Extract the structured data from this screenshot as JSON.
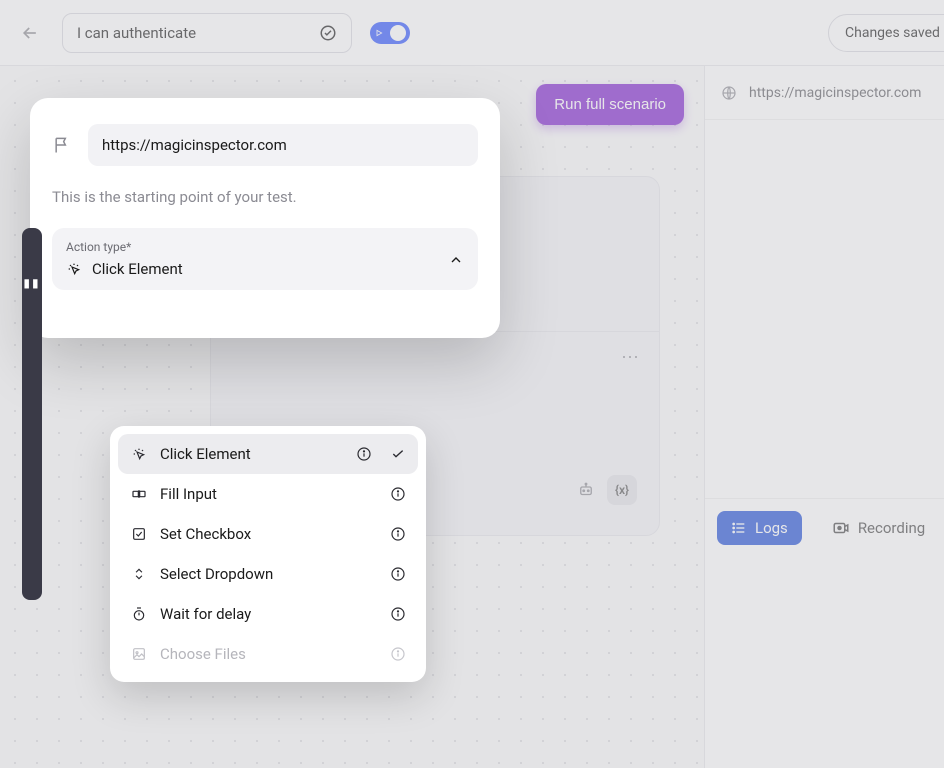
{
  "topbar": {
    "title_value": "I can authenticate",
    "saved_label": "Changes saved a",
    "toggle_on": true
  },
  "canvas": {
    "run_button_label": "Run full scenario"
  },
  "right_panel": {
    "url": "https://magicinspector.com",
    "tabs": {
      "logs": "Logs",
      "recording": "Recording"
    }
  },
  "step_card_bg": {
    "var_badge": "{x}"
  },
  "modal": {
    "url_value": "https://magicinspector.com",
    "caption": "This is the starting point of your test.",
    "action": {
      "label": "Action type",
      "required_star": "*",
      "value": "Click Element"
    },
    "dropdown": {
      "items": [
        {
          "label": "Click Element",
          "icon": "cursor-click",
          "selected": true,
          "disabled": false
        },
        {
          "label": "Fill Input",
          "icon": "fill-input",
          "selected": false,
          "disabled": false
        },
        {
          "label": "Set Checkbox",
          "icon": "checkbox",
          "selected": false,
          "disabled": false
        },
        {
          "label": "Select Dropdown",
          "icon": "updown",
          "selected": false,
          "disabled": false
        },
        {
          "label": "Wait for delay",
          "icon": "stopwatch",
          "selected": false,
          "disabled": false
        },
        {
          "label": "Choose Files",
          "icon": "image",
          "selected": false,
          "disabled": true
        }
      ]
    }
  }
}
